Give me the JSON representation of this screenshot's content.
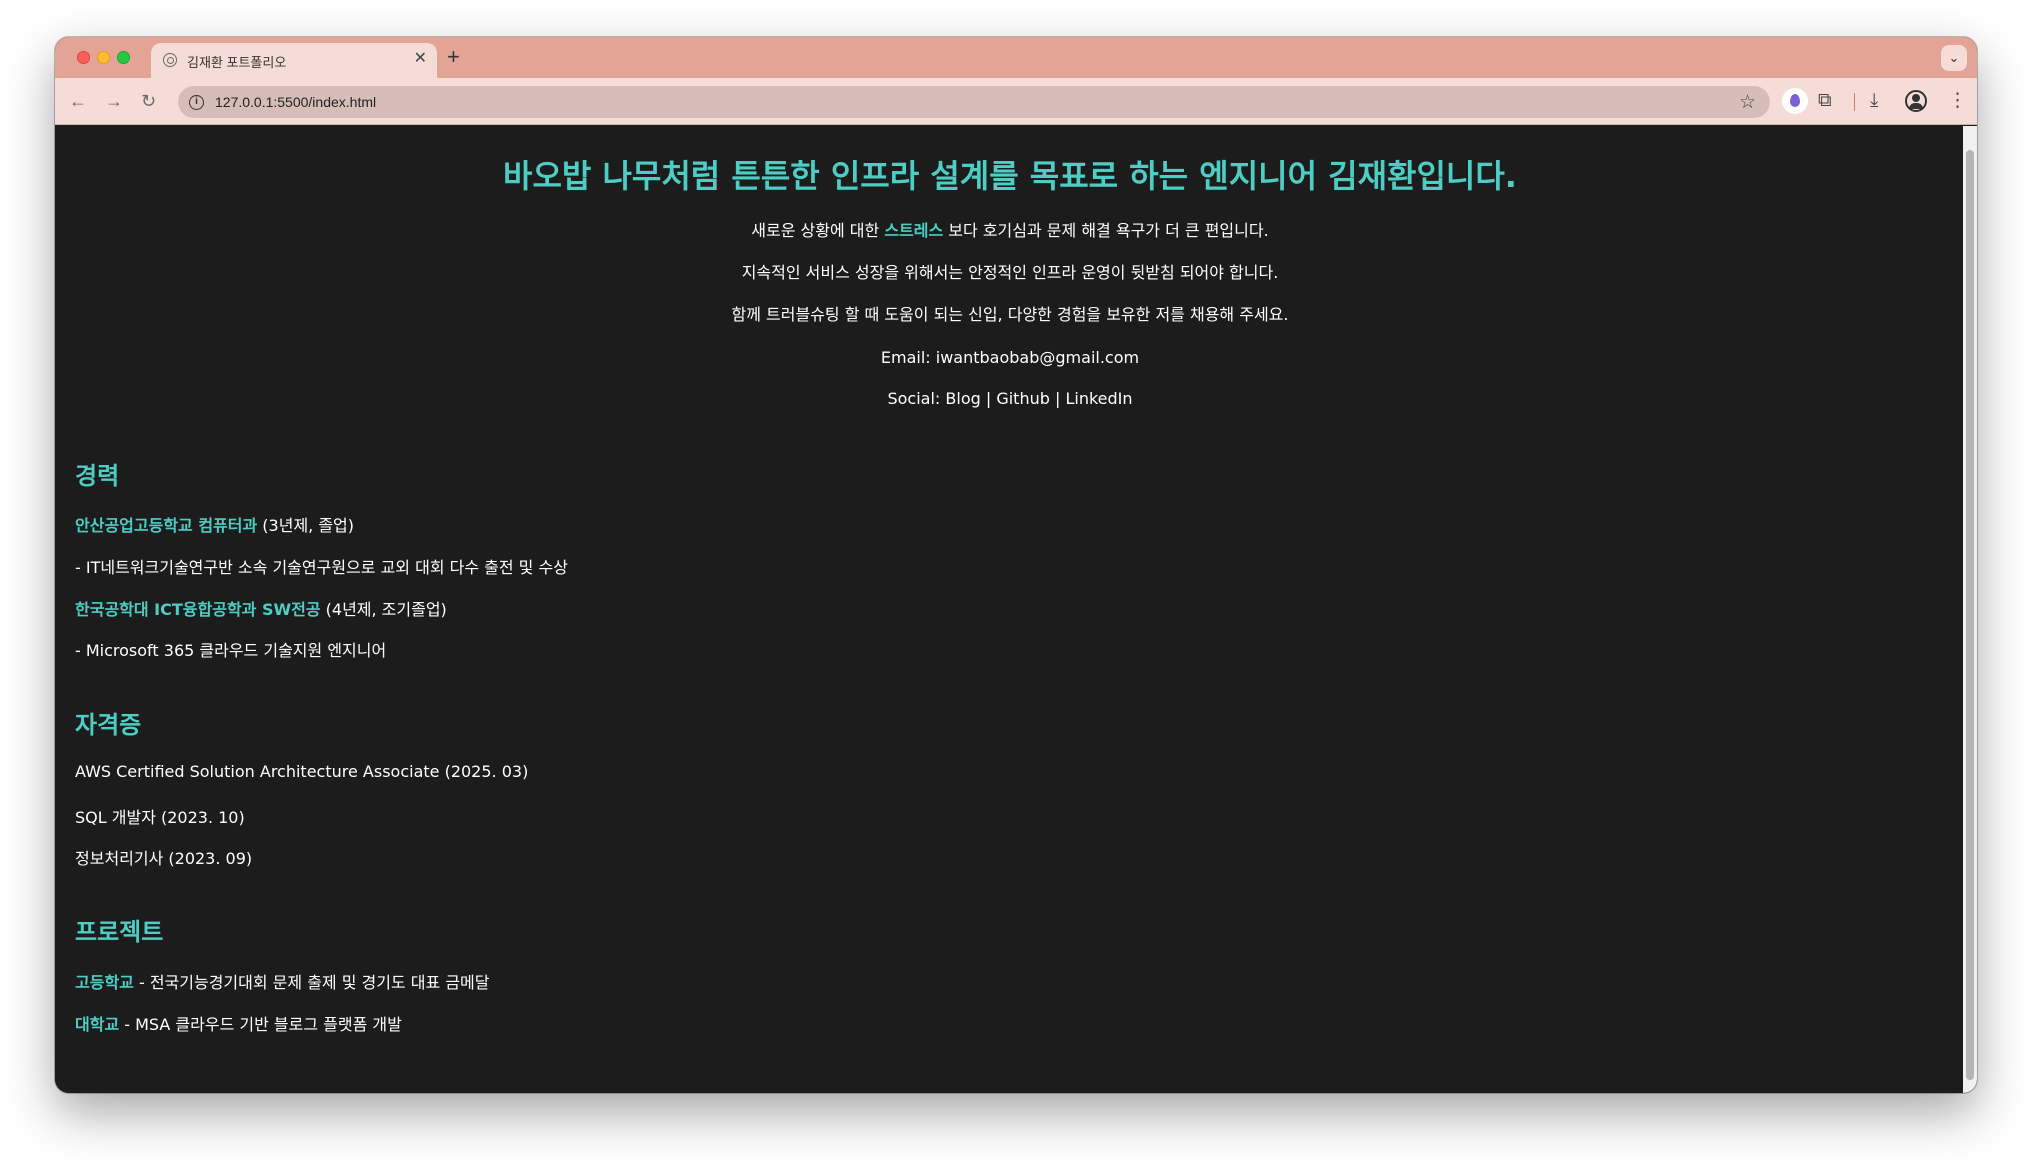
{
  "browser": {
    "tab_title": "김재환 포트폴리오",
    "tab_close": "✕",
    "new_tab": "+",
    "url": "127.0.0.1:5500/index.html"
  },
  "hero": {
    "title": "바오밥 나무처럼 튼튼한 인프라 설계를 목표로 하는 엔지니어 김재환입니다.",
    "line1_before": "새로운 상황에 대한 ",
    "line1_accent": "스트레스",
    "line1_after": " 보다 호기심과 문제 해결 욕구가 더 큰 편입니다.",
    "line2": "지속적인 서비스 성장을 위해서는 안정적인 인프라 운영이 뒷받침 되어야 합니다.",
    "line3": "함께 트러블슈팅 할 때 도움이 되는 신입, 다양한 경험을 보유한 저를 채용해 주세요.",
    "email": "Email: iwantbaobab@gmail.com",
    "social_prefix": "Social: ",
    "social_blog": "Blog",
    "social_sep1": " | ",
    "social_github": "Github",
    "social_sep2": " | ",
    "social_linkedin": "LinkedIn"
  },
  "career": {
    "heading": "경력",
    "school1_link": "안산공업고등학교 컴퓨터과",
    "school1_note": " (3년제, 졸업)",
    "school1_detail": "- IT네트워크기술연구반 소속 기술연구원으로 교외 대회 다수 출전 및 수상",
    "school2_link": "한국공학대 ICT융합공학과 SW전공",
    "school2_note": " (4년제, 조기졸업)",
    "school2_detail": "- Microsoft 365 클라우드 기술지원 엔지니어"
  },
  "certs": {
    "heading": "자격증",
    "items": [
      "AWS Certified Solution Architecture Associate (2025. 03)",
      "SQL 개발자 (2023. 10)",
      "정보처리기사 (2023. 09)"
    ]
  },
  "projects": {
    "heading": "프로젝트",
    "p1_link": "고등학교",
    "p1_text": " - 전국기능경기대회 문제 출제 및 경기도 대표 금메달",
    "p2_link": "대학교",
    "p2_text": " - MSA 클라우드 기반 블로그 플랫폼 개발"
  },
  "colors": {
    "accent": "#4ecdc4",
    "page_bg": "#1c1c1c",
    "tabstrip": "#e3a395"
  }
}
